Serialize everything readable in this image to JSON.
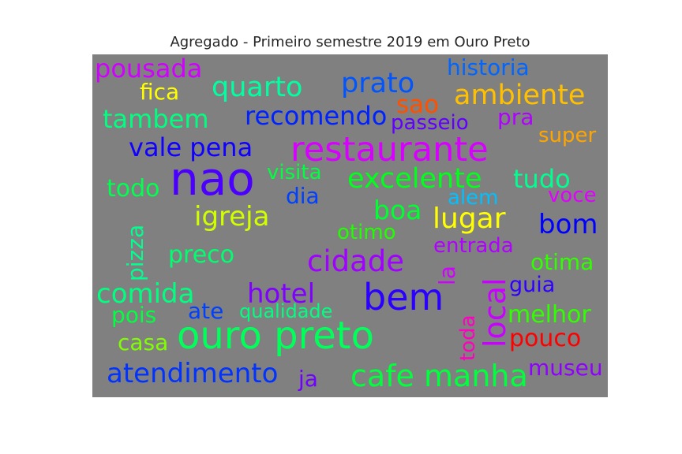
{
  "title": "Agregado - Primeiro semestre 2019 em Ouro Preto",
  "chart_data": {
    "type": "wordcloud",
    "title": "Agregado - Primeiro semestre 2019 em Ouro Preto",
    "background": "#808080",
    "words": [
      {
        "text": "nao",
        "color": "#4b00ff"
      },
      {
        "text": "ouro preto",
        "color": "#00ff5a"
      },
      {
        "text": "restaurante",
        "color": "#d700ff"
      },
      {
        "text": "bem",
        "color": "#2b00ff"
      },
      {
        "text": "cafe manha",
        "color": "#00ff3c"
      },
      {
        "text": "local",
        "color": "#c800ff"
      },
      {
        "text": "cidade",
        "color": "#a000ff"
      },
      {
        "text": "atendimento",
        "color": "#0033ff"
      },
      {
        "text": "lugar",
        "color": "#ffff00"
      },
      {
        "text": "excelente",
        "color": "#00ff1a"
      },
      {
        "text": "ambiente",
        "color": "#ffc000"
      },
      {
        "text": "prato",
        "color": "#0055ff"
      },
      {
        "text": "quarto",
        "color": "#00ffa0"
      },
      {
        "text": "igreja",
        "color": "#cfff00"
      },
      {
        "text": "hotel",
        "color": "#8000ff"
      },
      {
        "text": "comida",
        "color": "#00ff80"
      },
      {
        "text": "pousada",
        "color": "#d000ff"
      },
      {
        "text": "tambem",
        "color": "#00ff80"
      },
      {
        "text": "recomendo",
        "color": "#0022ff"
      },
      {
        "text": "vale pena",
        "color": "#1000ff"
      },
      {
        "text": "tudo",
        "color": "#00ff90"
      },
      {
        "text": "bom",
        "color": "#0000ff"
      },
      {
        "text": "boa",
        "color": "#00ff30"
      },
      {
        "text": "todo",
        "color": "#00ff50"
      },
      {
        "text": "preco",
        "color": "#00ff70"
      },
      {
        "text": "historia",
        "color": "#0066ff"
      },
      {
        "text": "sao",
        "color": "#ff5000"
      },
      {
        "text": "fica",
        "color": "#ffff00"
      },
      {
        "text": "passeio",
        "color": "#6000ff"
      },
      {
        "text": "pra",
        "color": "#b000ff"
      },
      {
        "text": "super",
        "color": "#ffa500"
      },
      {
        "text": "visita",
        "color": "#00ff40"
      },
      {
        "text": "dia",
        "color": "#0040ff"
      },
      {
        "text": "alem",
        "color": "#00c0ff"
      },
      {
        "text": "voce",
        "color": "#e000ff"
      },
      {
        "text": "otimo",
        "color": "#20ff00"
      },
      {
        "text": "entrada",
        "color": "#b000ff"
      },
      {
        "text": "otima",
        "color": "#30ff00"
      },
      {
        "text": "pizza",
        "color": "#00ff90"
      },
      {
        "text": "la",
        "color": "#d000ff"
      },
      {
        "text": "guia",
        "color": "#3000ff"
      },
      {
        "text": "pois",
        "color": "#00ff40"
      },
      {
        "text": "ate",
        "color": "#0040ff"
      },
      {
        "text": "qualidade",
        "color": "#00ff80"
      },
      {
        "text": "melhor",
        "color": "#30ff00"
      },
      {
        "text": "casa",
        "color": "#80ff00"
      },
      {
        "text": "toda",
        "color": "#ff00c0"
      },
      {
        "text": "pouco",
        "color": "#ff0000"
      },
      {
        "text": "ja",
        "color": "#7000ff"
      },
      {
        "text": "museu",
        "color": "#9000ff"
      }
    ]
  }
}
